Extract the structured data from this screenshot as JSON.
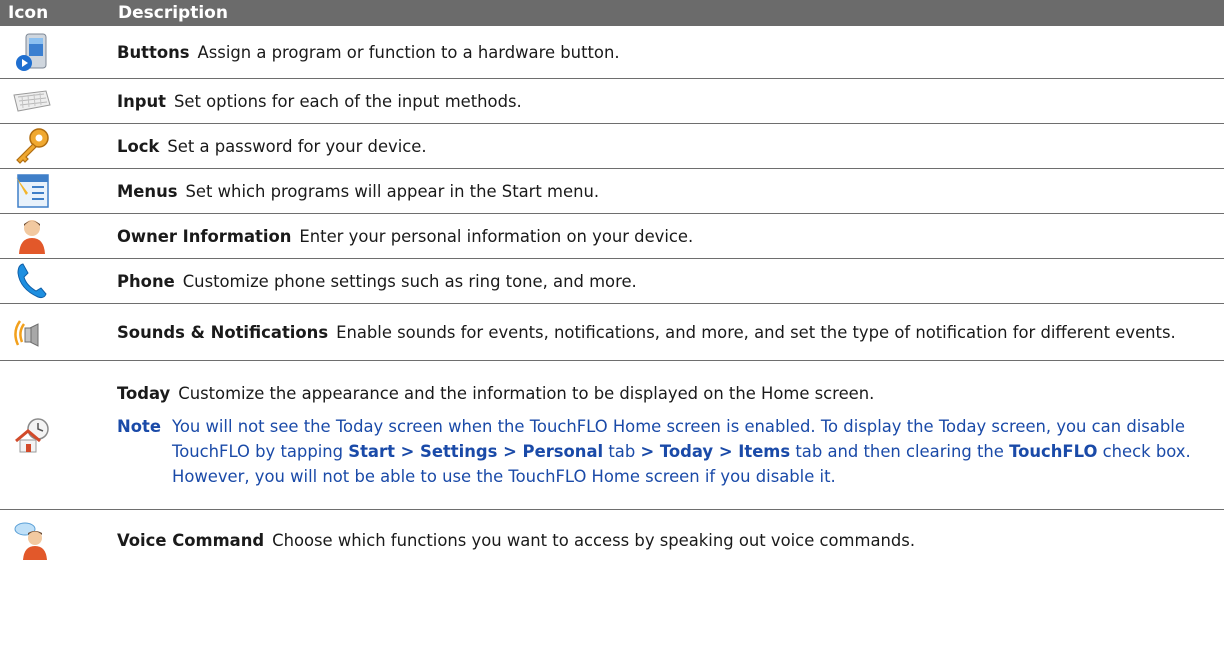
{
  "header": {
    "icon_col": "Icon",
    "desc_col": "Description"
  },
  "rows": [
    {
      "icon": "phone-buttons-icon",
      "name": "Buttons",
      "desc": "Assign a program or function to a hardware button."
    },
    {
      "icon": "keyboard-icon",
      "name": "Input",
      "desc": "Set options for each of the input methods."
    },
    {
      "icon": "key-icon",
      "name": "Lock",
      "desc": "Set a password for your device."
    },
    {
      "icon": "menu-window-icon",
      "name": "Menus",
      "desc": "Set which programs will appear in the Start menu."
    },
    {
      "icon": "person-icon",
      "name": "Owner Information",
      "desc": "Enter your personal information on your device."
    },
    {
      "icon": "phone-handset-icon",
      "name": "Phone",
      "desc": "Customize phone settings such as ring tone, and more."
    },
    {
      "icon": "speaker-icon",
      "name": "Sounds & Notifications",
      "desc": "Enable sounds for events, notifications, and more, and set the type of notification for different events."
    },
    {
      "icon": "house-clock-icon",
      "name": "Today",
      "desc": "Customize the appearance and the information to be displayed on the Home screen.",
      "note": {
        "label": "Note",
        "t1": "You will not see the Today screen when the TouchFLO Home screen is enabled. To display the Today screen, you can disable TouchFLO by tapping ",
        "b1": "Start > Settings > Personal",
        "t2": " tab ",
        "b2": "> Today > Items",
        "t3": " tab and then clearing the ",
        "b3": "TouchFLO",
        "t4": " check box. However, you will not be able to use the TouchFLO Home screen if you disable it."
      }
    },
    {
      "icon": "voice-person-icon",
      "name": "Voice Command",
      "desc": "Choose which functions you want to access by speaking out voice commands."
    }
  ]
}
